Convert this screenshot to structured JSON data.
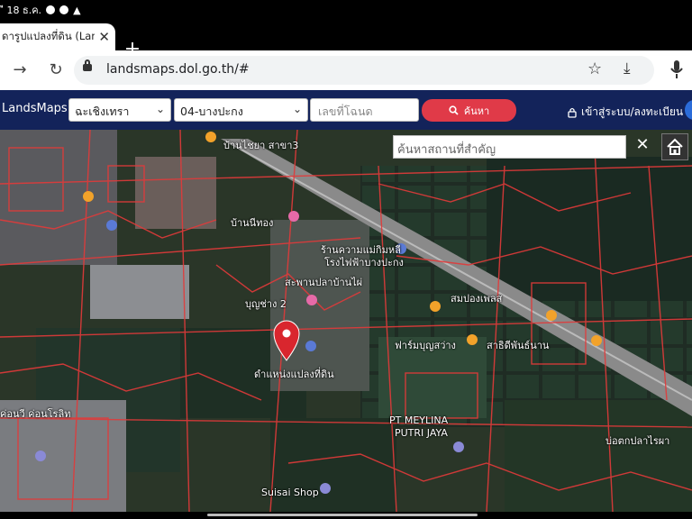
{
  "status_bar": {
    "date": "ี 18 ธ.ค."
  },
  "browser": {
    "tab_title": "ดารูปแปลงที่ดิน (Lan",
    "url": "landsmaps.dol.go.th/#",
    "icons": {
      "back": "back-arrow-icon",
      "reload": "reload-icon",
      "star": "star-icon",
      "download": "download-icon",
      "mic": "mic-icon"
    }
  },
  "navbar": {
    "brand": "LandsMaps",
    "province_select": "ฉะเชิงเทรา",
    "district_select": "04-บางปะกง",
    "deed_placeholder": "เลขที่โฉนด",
    "search_label": "ค้นหา",
    "login_label": "เข้าสู่ระบบ/ลงทะเบียน",
    "bg_color": "#13235a",
    "accent_color": "#e03a48"
  },
  "map": {
    "poi_search_placeholder": "ค้นหาสถานที่สำคัญ",
    "labels": {
      "l1": "บ้านไชยา สาขา3",
      "l2": "บ้านนีทอง",
      "l3": "ร้านความแม่กิมหลี",
      "l4": "โรงไฟฟ้าบางปะกง",
      "l5": "สะพานปลาบ้านไผ่",
      "l6": "บุญช่าง 2",
      "l7": "สมปองเพลส",
      "l8": "ฟาร์มบุญสว่าง",
      "l9": "สาธิดีพันธ์นาน",
      "l10": "ดำแหน่งแปลงที่ดิน",
      "l11": "PT MEYLINA",
      "l12": "PUTRI JAYA",
      "l13": "Suisai Shop",
      "l14": "บ่อตกปลาไรผา",
      "l15": "ค่อนวี ค่อนโรลิท"
    }
  }
}
